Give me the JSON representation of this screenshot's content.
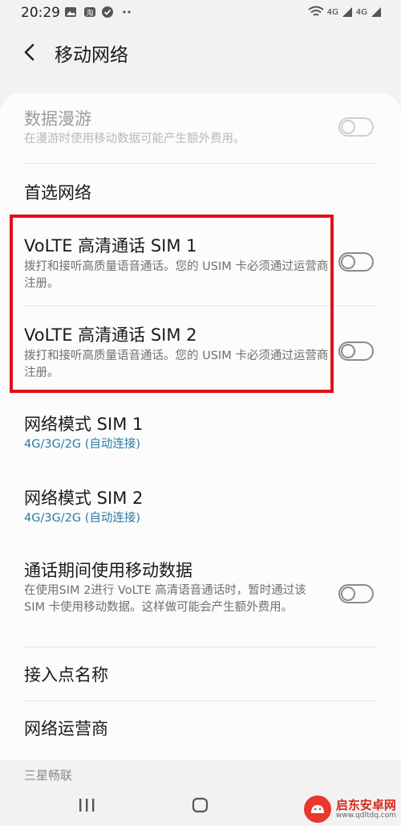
{
  "status_bar": {
    "time": "20:29",
    "network_labels": [
      "4G",
      "4G"
    ]
  },
  "header": {
    "title": "移动网络",
    "back_icon": "back-arrow-icon"
  },
  "settings": {
    "data_roaming": {
      "title": "数据漫游",
      "subtitle": "在漫游时使用移动数据可能产生额外费用。",
      "enabled": false,
      "disabled": true
    },
    "preferred_network": {
      "title": "首选网络"
    },
    "volte_sim1": {
      "title": "VoLTE 高清通话 SIM 1",
      "subtitle": "拨打和接听高质量语音通话。您的 USIM 卡必须通过运营商注册。",
      "enabled": false
    },
    "volte_sim2": {
      "title": "VoLTE 高清通话 SIM 2",
      "subtitle": "拨打和接听高质量语音通话。您的 USIM 卡必须通过运营商注册。",
      "enabled": false
    },
    "network_mode_sim1": {
      "title": "网络模式 SIM 1",
      "value": "4G/3G/2G (自动连接)"
    },
    "network_mode_sim2": {
      "title": "网络模式 SIM 2",
      "value": "4G/3G/2G (自动连接)"
    },
    "data_during_calls": {
      "title": "通话期间使用移动数据",
      "subtitle": "在使用SIM 2进行 VoLTE 高清语音通话时，暂时通过该 SIM 卡使用移动数据。这样做可能会产生额外费用。",
      "enabled": false
    },
    "access_point_names": {
      "title": "接入点名称"
    },
    "network_operators": {
      "title": "网络运营商"
    },
    "section_label": "三星畅联"
  },
  "watermark": {
    "brand": "启东安卓网",
    "url": "www.qdltdq.com"
  },
  "colors": {
    "highlight": "#e0111a",
    "link_blue": "#2a7aa3",
    "background": "#f2f2f2"
  }
}
